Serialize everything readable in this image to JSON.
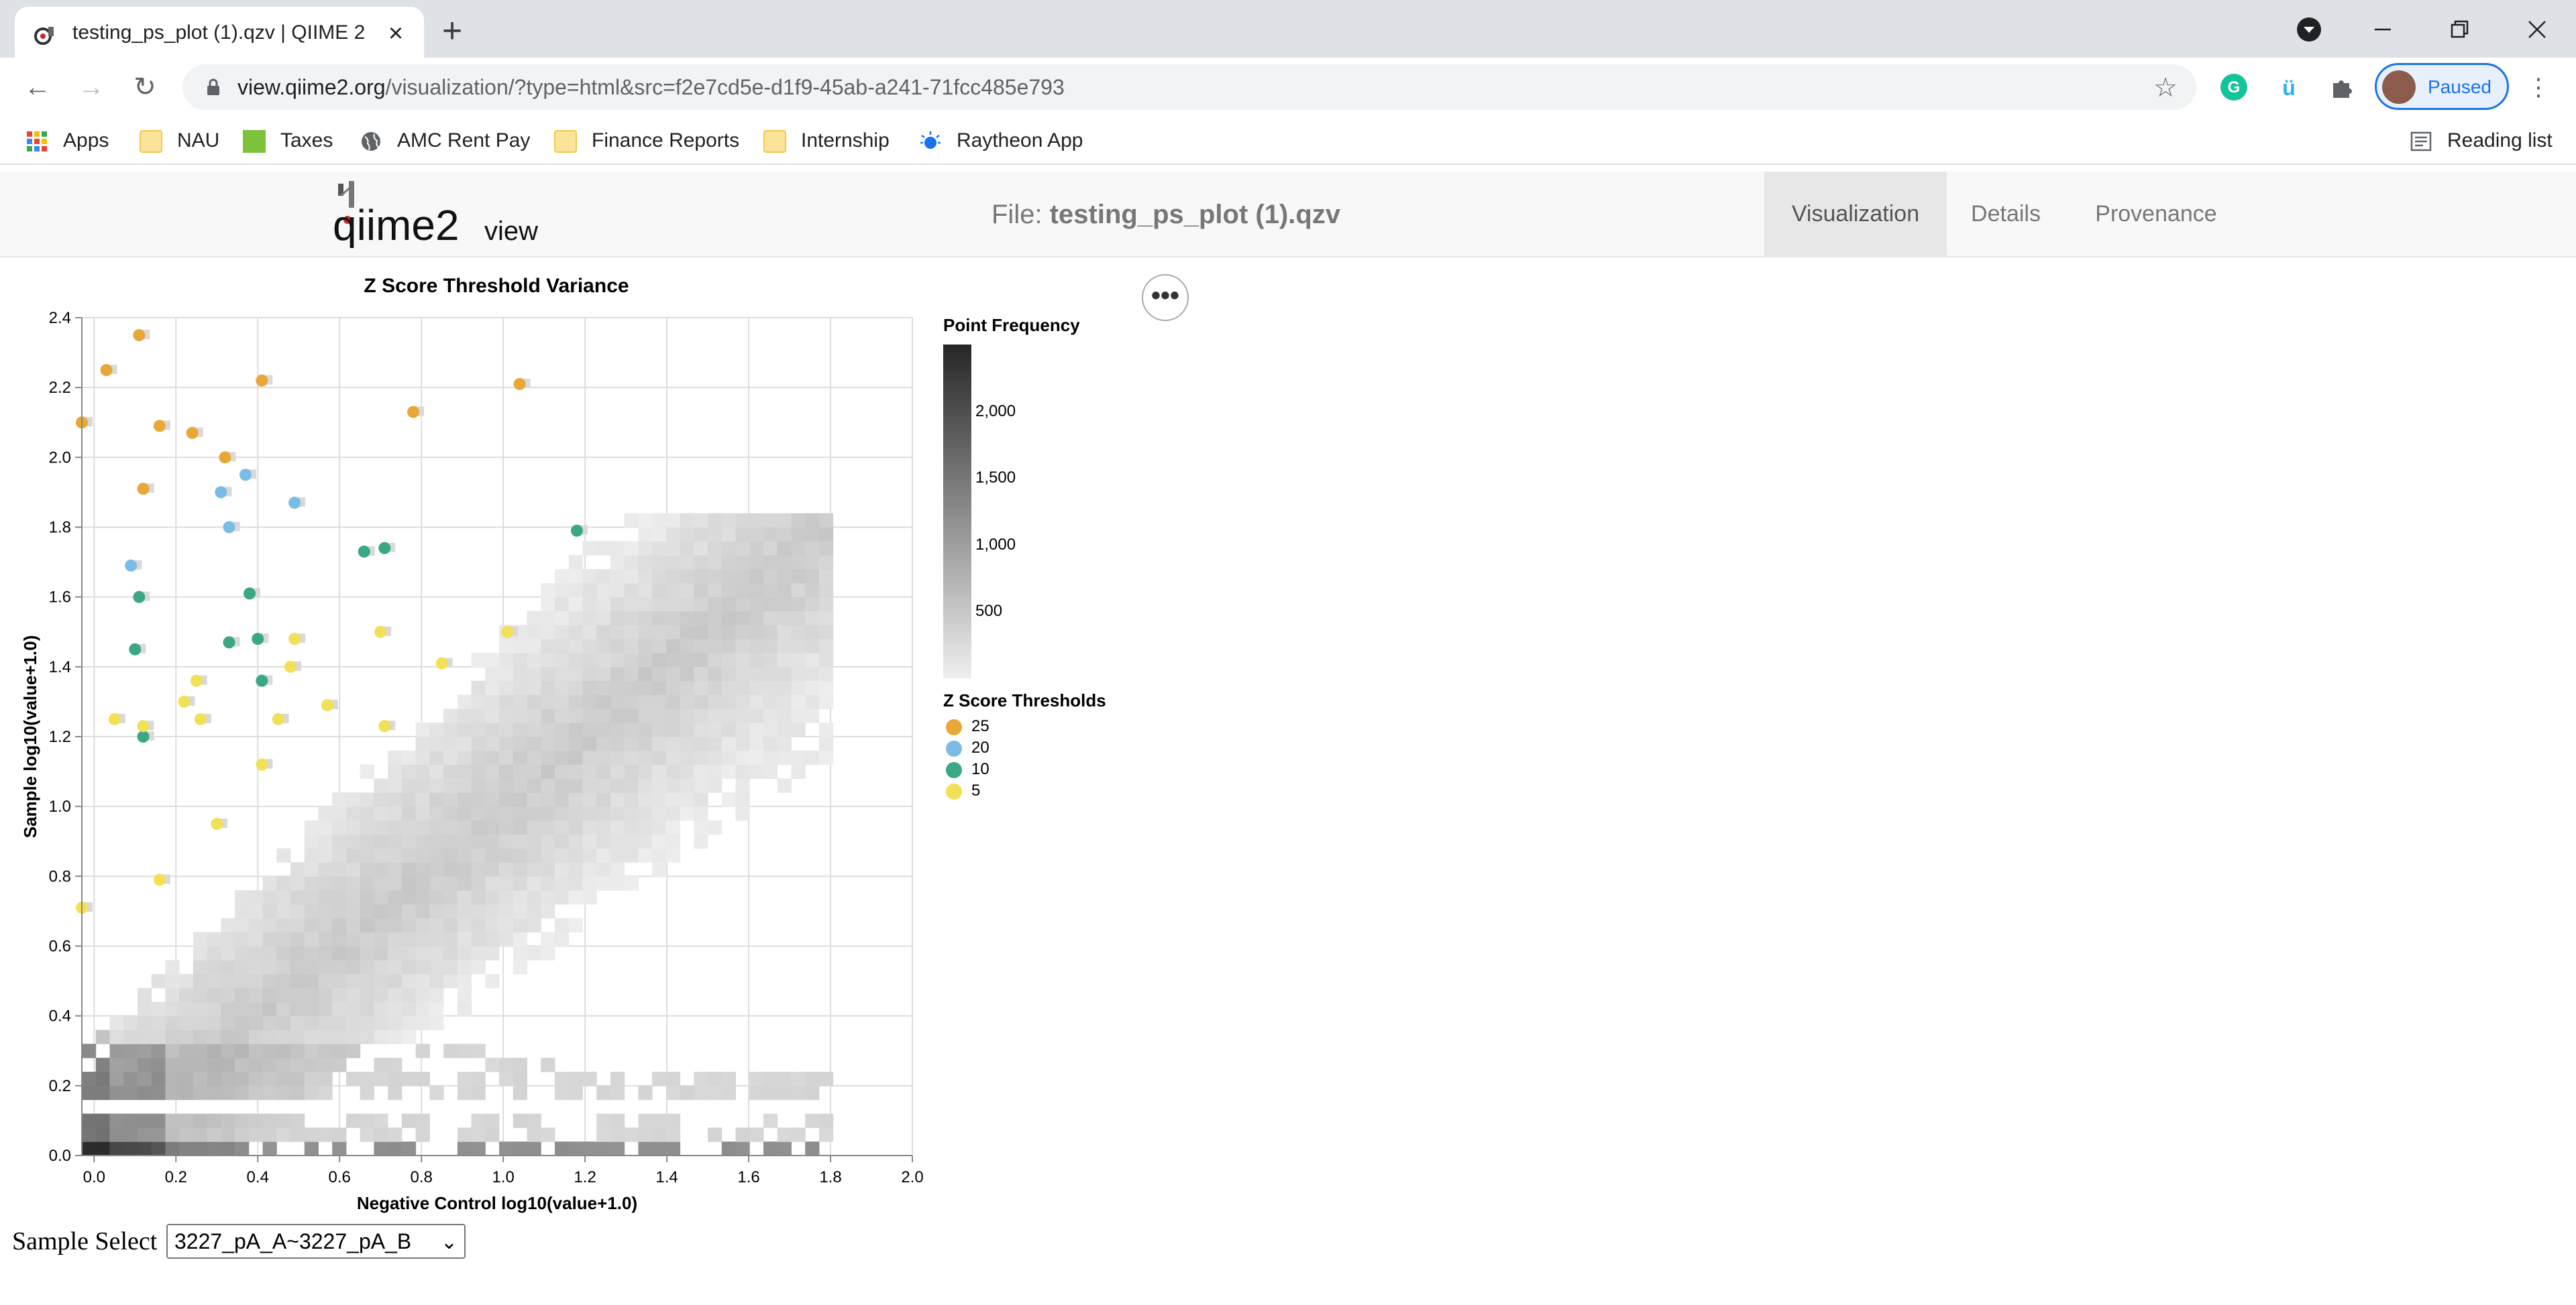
{
  "browser": {
    "tab_title": "testing_ps_plot (1).qzv | QIIME 2 View",
    "url_host": "view.qiime2.org",
    "url_path": "/visualization/?type=html&src=f2e7cd5e-d1f9-45ab-a241-71fcc485e793",
    "profile_label": "Paused",
    "bookmarks": [
      {
        "label": "Apps",
        "icon": "apps-grid-icon"
      },
      {
        "label": "NAU",
        "icon": "folder-icon"
      },
      {
        "label": "Taxes",
        "icon": "green-square-icon"
      },
      {
        "label": "AMC Rent Pay",
        "icon": "globe-icon"
      },
      {
        "label": "Finance Reports",
        "icon": "folder-icon"
      },
      {
        "label": "Internship",
        "icon": "folder-icon"
      },
      {
        "label": "Raytheon App",
        "icon": "raytheon-icon"
      }
    ],
    "reading_list": "Reading list"
  },
  "qiime": {
    "logo_text_main": "qiime2",
    "logo_text_sub": "view",
    "file_prefix": "File:",
    "file_name": "testing_ps_plot (1).qzv",
    "nav": [
      "Visualization",
      "Details",
      "Provenance"
    ],
    "active_nav": "Visualization"
  },
  "chart_data": {
    "type": "scatter",
    "title": "Z Score Threshold Variance",
    "xlabel": "Negative Control log10(value+1.0)",
    "ylabel": "Sample log10(value+1.0)",
    "xlim": [
      -0.03,
      2.0
    ],
    "ylim": [
      0.0,
      2.4
    ],
    "x_ticks": [
      "0.0",
      "0.2",
      "0.4",
      "0.6",
      "0.8",
      "1.0",
      "1.2",
      "1.4",
      "1.6",
      "1.8",
      "2.0"
    ],
    "y_ticks": [
      "0.0",
      "0.2",
      "0.4",
      "0.6",
      "0.8",
      "1.0",
      "1.2",
      "1.4",
      "1.6",
      "1.8",
      "2.0",
      "2.2",
      "2.4"
    ],
    "grid": true,
    "density_legend": {
      "title": "Point Frequency",
      "ticks": [
        "2,000",
        "1,500",
        "1,000",
        "500"
      ],
      "tick_values": [
        2000,
        1500,
        1000,
        500
      ],
      "max": 2500
    },
    "threshold_legend": {
      "title": "Z Score Thresholds",
      "items": [
        {
          "label": "25",
          "color": "#e8a838"
        },
        {
          "label": "20",
          "color": "#7bbce6"
        },
        {
          "label": "10",
          "color": "#3aa886"
        },
        {
          "label": "5",
          "color": "#f2e056"
        }
      ]
    },
    "series": [
      {
        "name": "25",
        "color": "#e8a838",
        "points": [
          [
            -0.03,
            2.1
          ],
          [
            0.03,
            2.25
          ],
          [
            0.11,
            2.35
          ],
          [
            0.16,
            2.09
          ],
          [
            0.24,
            2.07
          ],
          [
            0.32,
            2.0
          ],
          [
            0.12,
            1.91
          ],
          [
            0.41,
            2.22
          ],
          [
            0.78,
            2.13
          ],
          [
            1.04,
            2.21
          ]
        ]
      },
      {
        "name": "20",
        "color": "#7bbce6",
        "points": [
          [
            0.09,
            1.69
          ],
          [
            0.31,
            1.9
          ],
          [
            0.37,
            1.95
          ],
          [
            0.49,
            1.87
          ],
          [
            0.33,
            1.8
          ]
        ]
      },
      {
        "name": "10",
        "color": "#3aa886",
        "points": [
          [
            0.11,
            1.6
          ],
          [
            0.1,
            1.45
          ],
          [
            0.12,
            1.2
          ],
          [
            0.33,
            1.47
          ],
          [
            0.38,
            1.61
          ],
          [
            0.4,
            1.48
          ],
          [
            0.41,
            1.36
          ],
          [
            0.66,
            1.73
          ],
          [
            0.71,
            1.74
          ],
          [
            1.18,
            1.79
          ]
        ]
      },
      {
        "name": "5",
        "color": "#f2e056",
        "points": [
          [
            -0.03,
            0.71
          ],
          [
            0.05,
            1.25
          ],
          [
            0.12,
            1.23
          ],
          [
            0.16,
            0.79
          ],
          [
            0.22,
            1.3
          ],
          [
            0.25,
            1.36
          ],
          [
            0.26,
            1.25
          ],
          [
            0.3,
            0.95
          ],
          [
            0.41,
            1.12
          ],
          [
            0.45,
            1.25
          ],
          [
            0.49,
            1.48
          ],
          [
            0.48,
            1.4
          ],
          [
            0.57,
            1.29
          ],
          [
            0.7,
            1.5
          ],
          [
            0.71,
            1.23
          ],
          [
            0.85,
            1.41
          ],
          [
            1.01,
            1.5
          ]
        ]
      }
    ]
  },
  "sample_select": {
    "label": "Sample Select",
    "value": "3227_pA_A~3227_pA_B"
  }
}
